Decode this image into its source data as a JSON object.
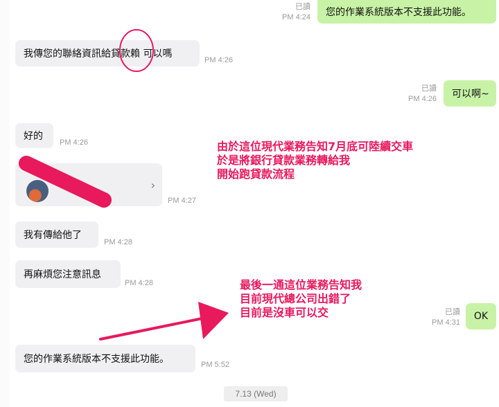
{
  "messages": {
    "m1": {
      "text": "您的作業系統版本不支援此功能。",
      "read": "已讀",
      "time": "PM 4:24"
    },
    "m2": {
      "text": "我傳您的聯絡資訊給貸款賴 可以嗎",
      "time": "PM 4:26"
    },
    "m3": {
      "text": "可以啊~",
      "read": "已讀",
      "time": "PM 4:26"
    },
    "m4": {
      "text": "好的",
      "time": "PM 4:26"
    },
    "m5": {
      "time": "PM 4:27"
    },
    "m6": {
      "text": "我有傳給他了",
      "time": "PM 4:28"
    },
    "m7": {
      "text": "再麻煩您注意訊息",
      "time": "PM 4:28"
    },
    "m8": {
      "text": "OK",
      "read": "已讀",
      "time": "PM 4:31"
    },
    "m9": {
      "text": "您的作業系統版本不支援此功能。",
      "time": "PM 5:52"
    }
  },
  "date_divider": "7.13 (Wed)",
  "annotations": {
    "note1": [
      "由於這位現代業務告知7月底可陸續交車",
      "於是將銀行貸款業務轉給我",
      "開始跑貸款流程"
    ],
    "note2": [
      "最後一通這位業務告知我",
      "目前現代總公司出錯了",
      "目前是沒車可以交"
    ]
  },
  "icons": {
    "card_chevron": "chevron-right-icon"
  },
  "colors": {
    "incoming": "#f0f0f3",
    "outgoing": "#c8f3a6",
    "annotation": "#e8195c"
  }
}
